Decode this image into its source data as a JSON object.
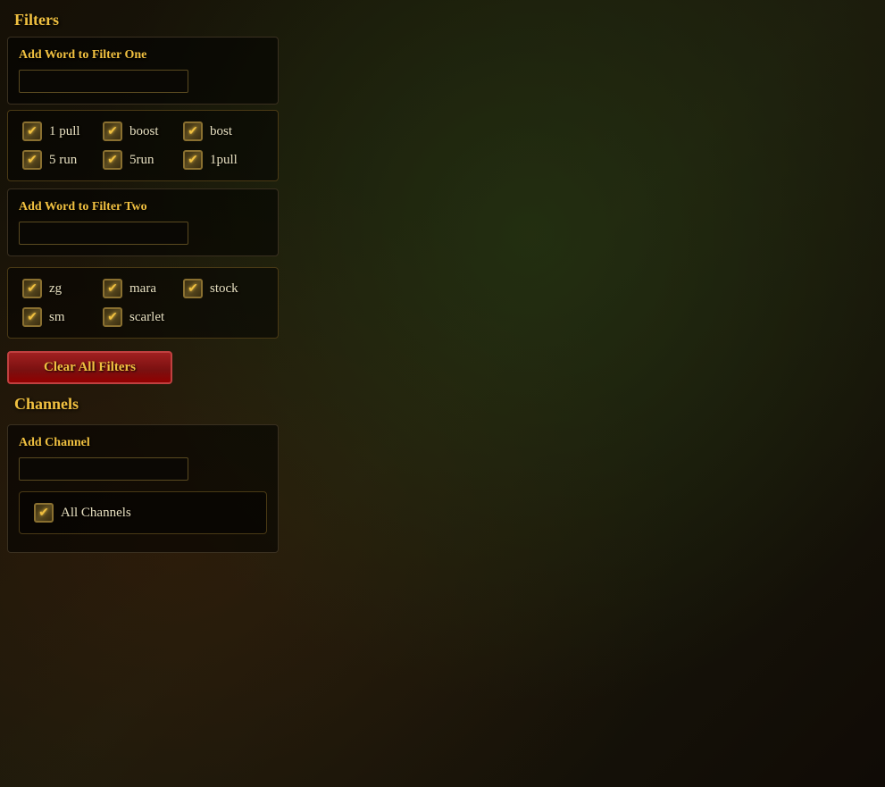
{
  "title": "Filters",
  "filter_one": {
    "label": "Add Word to Filter One",
    "input_placeholder": "",
    "input_value": "",
    "items": [
      {
        "col": 0,
        "label": "1 pull",
        "checked": true
      },
      {
        "col": 1,
        "label": "boost",
        "checked": true
      },
      {
        "col": 2,
        "label": "bost",
        "checked": true
      },
      {
        "col": 0,
        "label": "5 run",
        "checked": true
      },
      {
        "col": 1,
        "label": "5run",
        "checked": true
      },
      {
        "col": 2,
        "label": "1pull",
        "checked": true
      }
    ]
  },
  "filter_two": {
    "label": "Add Word to Filter Two",
    "input_placeholder": "",
    "input_value": "",
    "items": [
      {
        "col": 0,
        "label": "zg",
        "checked": true
      },
      {
        "col": 1,
        "label": "mara",
        "checked": true
      },
      {
        "col": 2,
        "label": "stock",
        "checked": true
      },
      {
        "col": 0,
        "label": "sm",
        "checked": true
      },
      {
        "col": 1,
        "label": "scarlet",
        "checked": true
      }
    ]
  },
  "clear_button_label": "Clear All Filters",
  "channels": {
    "title": "Channels",
    "add_label": "Add Channel",
    "input_placeholder": "",
    "input_value": "",
    "items": [
      {
        "label": "All Channels",
        "checked": true
      }
    ]
  }
}
